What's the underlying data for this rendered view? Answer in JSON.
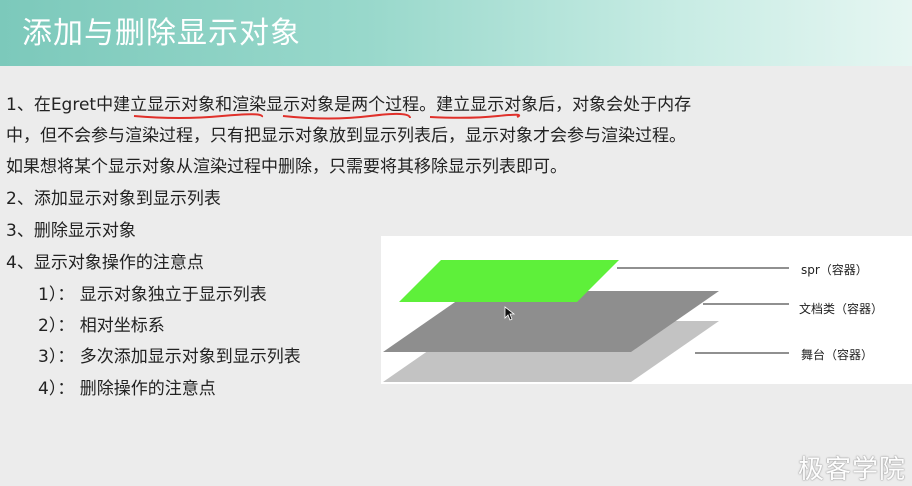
{
  "banner": {
    "title": "添加与删除显示对象"
  },
  "content": {
    "p1_num": "1、在Egret中",
    "p1_u1": "建立显示对象",
    "p1_and": "和",
    "p1_u2": "渲染显示对象",
    "p1_is": "是",
    "p1_u3": "两个过程",
    "p1_rest": "。建立显示对象后，对象会处于内存",
    "p1_line2": "中，但不会参与渲染过程，只有把显示对象放到显示列表后，显示对象才会参与渲染过程。",
    "p1_line3": "如果想将某个显示对象从渲染过程中删除，只需要将其移除显示列表即可。",
    "item2": "2、添加显示对象到显示列表",
    "item3": "3、删除显示对象",
    "item4": "4、显示对象操作的注意点",
    "sub_items": [
      "1）：  显示对象独立于显示列表",
      "2）：  相对坐标系",
      "3）：  多次添加显示对象到显示列表",
      "4）：  删除操作的注意点"
    ]
  },
  "diagram": {
    "labels": [
      "spr（容器）",
      "文档类（容器）",
      "舞台（容器）"
    ],
    "colors": {
      "top": "#5ef03a",
      "middle": "#8e8e8e",
      "bottom": "#c3c3c3",
      "underline": "#e0302a"
    }
  },
  "watermark": {
    "text": "极客学院"
  }
}
